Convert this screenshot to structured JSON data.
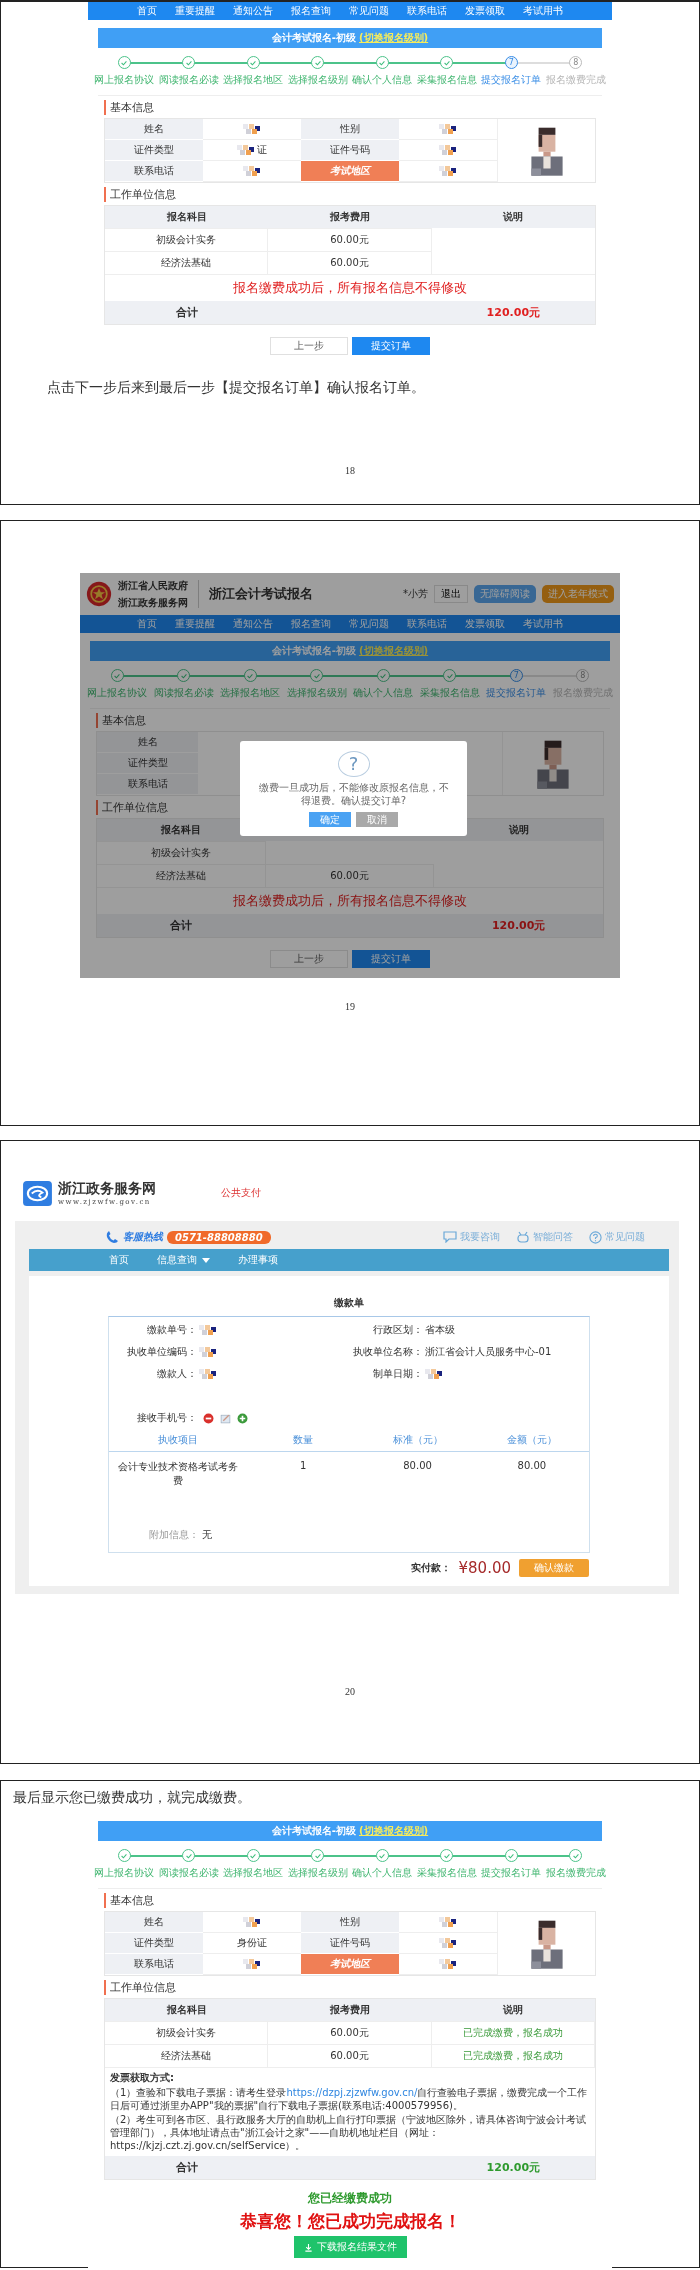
{
  "pages": [
    {
      "blocks": [
        {
          "kind": "registration",
          "paid": false,
          "nav": [
            "首页",
            "重要提醒",
            "通知公告",
            "报名查询",
            "常见问题",
            "联系电话",
            "发票领取",
            "考试用书"
          ],
          "title": "会计考试报名-初级",
          "title_link": "(切换报名级别)",
          "steps": [
            {
              "label": "网上报名协议",
              "done": true,
              "current": false
            },
            {
              "label": "阅读报名必读",
              "done": true,
              "current": false
            },
            {
              "label": "选择报名地区",
              "done": true,
              "current": false
            },
            {
              "label": "选择报名级别",
              "done": true,
              "current": false
            },
            {
              "label": "确认个人信息",
              "done": true,
              "current": false
            },
            {
              "label": "采集报名信息",
              "done": true,
              "current": false
            },
            {
              "label": "提交报名订单",
              "done": false,
              "current": true,
              "number": "7"
            },
            {
              "label": "报名缴费完成",
              "done": false,
              "current": false,
              "number": "8"
            }
          ],
          "basic_heading": "基本信息",
          "photo": {
            "kind": "picture"
          },
          "basic_rows": [
            [
              {
                "kind": "label",
                "text": "姓名",
                "highlight": false
              },
              {
                "kind": "value",
                "redacted": true
              },
              {
                "kind": "label",
                "text": "性别",
                "highlight": false
              },
              {
                "kind": "value",
                "redacted": true
              }
            ],
            [
              {
                "kind": "label",
                "text": "证件类型",
                "highlight": false
              },
              {
                "kind": "value",
                "text": "证",
                "redacted": true
              },
              {
                "kind": "label",
                "text": "证件号码",
                "highlight": false
              },
              {
                "kind": "value",
                "redacted": true
              }
            ],
            [
              {
                "kind": "label",
                "text": "联系电话",
                "highlight": false
              },
              {
                "kind": "value",
                "redacted": true
              },
              {
                "kind": "label",
                "text": "考试地区",
                "highlight": true
              },
              {
                "kind": "value",
                "redacted": true
              }
            ]
          ],
          "work_heading": "工作单位信息",
          "columns": [
            "报名科目",
            "报考费用",
            "说明"
          ],
          "rows": [
            {
              "subject": "初级会计实务",
              "fee": "60.00元"
            },
            {
              "subject": "经济法基础",
              "fee": "60.00元"
            }
          ],
          "notice": "报名缴费成功后，所有报名信息不得修改",
          "total_label": "合计",
          "total_value": "120.00元",
          "buttons": [
            {
              "label": "上一步",
              "kind": "default"
            },
            {
              "label": "提交订单",
              "kind": "primary"
            }
          ]
        },
        {
          "kind": "caption",
          "text": "点击下一步后来到最后一步【提交报名订单】确认报名订单。"
        },
        {
          "kind": "page_number",
          "text": "18"
        }
      ]
    },
    {
      "blocks": [
        {
          "kind": "registration",
          "paid": false,
          "header": {
            "gov_name": "浙江省人民政府",
            "portal": "浙江政务服务网",
            "site_title": "浙江会计考试报名",
            "user": "*小芳",
            "logout": "退出",
            "accessibility": "无障碍阅读",
            "elder_mode": "进入老年模式"
          },
          "nav": [
            "首页",
            "重要提醒",
            "通知公告",
            "报名查询",
            "常见问题",
            "联系电话",
            "发票领取",
            "考试用书"
          ],
          "title": "会计考试报名-初级",
          "title_link": "(切换报名级别)",
          "steps": [
            {
              "label": "网上报名协议",
              "done": true,
              "current": false
            },
            {
              "label": "阅读报名必读",
              "done": true,
              "current": false
            },
            {
              "label": "选择报名地区",
              "done": true,
              "current": false
            },
            {
              "label": "选择报名级别",
              "done": true,
              "current": false
            },
            {
              "label": "确认个人信息",
              "done": true,
              "current": false
            },
            {
              "label": "采集报名信息",
              "done": true,
              "current": false
            },
            {
              "label": "提交报名订单",
              "done": false,
              "current": true,
              "number": "7"
            },
            {
              "label": "报名缴费完成",
              "done": false,
              "current": false,
              "number": "8"
            }
          ],
          "basic_heading": "基本信息",
          "photo": {
            "kind": "picture"
          },
          "basic_rows": [
            [
              {
                "kind": "label",
                "text": "姓名",
                "highlight": false
              },
              {
                "kind": "value"
              },
              {
                "kind": "blank"
              },
              {
                "kind": "value"
              }
            ],
            [
              {
                "kind": "label",
                "text": "证件类型",
                "highlight": false
              },
              {
                "kind": "value"
              },
              {
                "kind": "blank"
              },
              {
                "kind": "value"
              }
            ],
            [
              {
                "kind": "label",
                "text": "联系电话",
                "highlight": false
              },
              {
                "kind": "value"
              },
              {
                "kind": "blank"
              },
              {
                "kind": "value"
              }
            ]
          ],
          "work_heading": "工作单位信息",
          "columns": [
            "报名科目",
            "",
            "说明"
          ],
          "rows": [
            {
              "subject": "初级会计实务"
            },
            {
              "subject": "经济法基础",
              "fee": "60.00元"
            }
          ],
          "notice": "报名缴费成功后，所有报名信息不得修改",
          "total_label": "合计",
          "total_value": "120.00元",
          "buttons": [
            {
              "label": "上一步",
              "kind": "default"
            },
            {
              "label": "提交订单",
              "kind": "primary"
            }
          ],
          "modal": {
            "icon": "?",
            "message": "缴费一旦成功后，不能修改原报名信息，不得退费。确认提交订单?",
            "buttons": [
              {
                "label": "确定",
                "kind": "primary"
              },
              {
                "label": "取消",
                "kind": "default"
              }
            ]
          }
        },
        {
          "kind": "page_number",
          "text": "19"
        }
      ]
    },
    {
      "blocks": [
        {
          "kind": "payment",
          "logo_name": "浙江政务服务网",
          "logo_url": "www.zjzwfw.gov.cn",
          "section": "公共支付",
          "hotline_label": "客服热线",
          "hotline": "0571-88808880",
          "links": [
            "我要咨询",
            "智能问答",
            "常见问题"
          ],
          "nav": [
            {
              "label": "首页",
              "dropdown": false
            },
            {
              "label": "信息查询",
              "dropdown": true
            },
            {
              "label": "办理事项",
              "dropdown": false
            }
          ],
          "form_title": "缴款单",
          "fields": [
            {
              "label": "缴款单号：",
              "redacted": true
            },
            {
              "label": "行政区划：",
              "value": "省本级"
            },
            {
              "label": "执收单位编码：",
              "redacted": true
            },
            {
              "label": "执收单位名称：",
              "value": "浙江省会计人员服务中心-01"
            },
            {
              "label": "缴款人：",
              "redacted": true
            },
            {
              "label": "制单日期：",
              "redacted": true
            }
          ],
          "phone_label": "接收手机号：",
          "columns": [
            "执收项目",
            "数量",
            "标准（元）",
            "金额（元）"
          ],
          "rows": [
            {
              "item": "会计专业技术资格考试考务费",
              "qty": "1",
              "standard": "80.00",
              "amount": "80.00"
            }
          ],
          "extra_label": "附加信息：",
          "extra_value": "无",
          "paid_label": "实付款：",
          "paid_amount": "¥80.00",
          "confirm": "确认缴款"
        },
        {
          "kind": "page_number",
          "text": "20"
        }
      ]
    },
    {
      "blocks": [
        {
          "kind": "caption",
          "text": "最后显示您已缴费成功，就完成缴费。"
        },
        {
          "kind": "registration",
          "paid": true,
          "title": "会计考试报名-初级",
          "title_link": "(切换报名级别)",
          "steps": [
            {
              "label": "网上报名协议",
              "done": true,
              "current": false
            },
            {
              "label": "阅读报名必读",
              "done": true,
              "current": false
            },
            {
              "label": "选择报名地区",
              "done": true,
              "current": false
            },
            {
              "label": "选择报名级别",
              "done": true,
              "current": false
            },
            {
              "label": "确认个人信息",
              "done": true,
              "current": false
            },
            {
              "label": "采集报名信息",
              "done": true,
              "current": false
            },
            {
              "label": "提交报名订单",
              "done": true,
              "current": false
            },
            {
              "label": "报名缴费完成",
              "done": true,
              "current": false
            }
          ],
          "basic_heading": "基本信息",
          "photo": {
            "kind": "picture"
          },
          "basic_rows": [
            [
              {
                "kind": "label",
                "text": "姓名",
                "highlight": false
              },
              {
                "kind": "value",
                "redacted": true
              },
              {
                "kind": "label",
                "text": "性别",
                "highlight": false
              },
              {
                "kind": "value",
                "redacted": true
              }
            ],
            [
              {
                "kind": "label",
                "text": "证件类型",
                "highlight": false
              },
              {
                "kind": "value",
                "text": "身份证"
              },
              {
                "kind": "label",
                "text": "证件号码",
                "highlight": false
              },
              {
                "kind": "value",
                "redacted": true
              }
            ],
            [
              {
                "kind": "label",
                "text": "联系电话",
                "highlight": false
              },
              {
                "kind": "value",
                "redacted": true
              },
              {
                "kind": "label",
                "text": "考试地区",
                "highlight": true
              },
              {
                "kind": "value",
                "redacted": true
              }
            ]
          ],
          "work_heading": "工作单位信息",
          "columns": [
            "报名科目",
            "报考费用",
            "说明"
          ],
          "rows": [
            {
              "subject": "初级会计实务",
              "fee": "60.00元",
              "note": "已完成缴费，报名成功"
            },
            {
              "subject": "经济法基础",
              "fee": "60.00元",
              "note": "已完成缴费，报名成功"
            }
          ],
          "invoice": {
            "heading": "发票获取方式:",
            "items": [
              {
                "before": "（1）查验和下载电子票据：请考生登录",
                "link": "https://dzpj.zjzwfw.gov.cn/",
                "after": "自行查验电子票据，缴费完成一个工作日后可通过浙里办APP\"我的票据\"自行下载电子票据(联系电话:4000579956)。"
              },
              {
                "before": "（2）考生可到各市区、县行政服务大厅的自助机上自行打印票据（宁波地区除外，请具体咨询宁波会计考试管理部门），具体地址请点击\"浙江会计之家\"——自助机地址栏目（网址：https://kjzj.czt.zj.gov.cn/selfService）。"
              }
            ]
          },
          "total_label": "合计",
          "total_value": "120.00元",
          "success": {
            "message": "您已经缴费成功",
            "congrats": "恭喜您！您已成功完成报名！",
            "download": "下载报名结果文件"
          }
        }
      ]
    }
  ]
}
